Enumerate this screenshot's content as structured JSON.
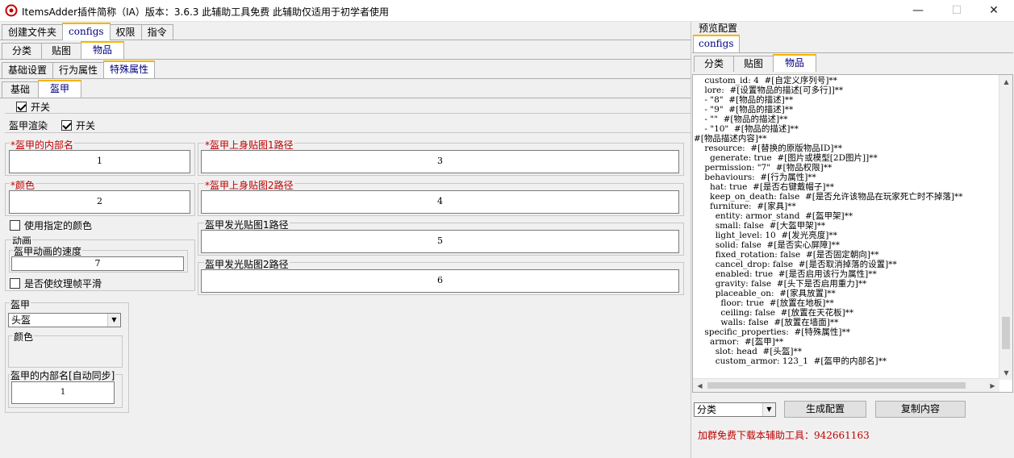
{
  "window": {
    "title": "ItemsAdder插件简称（IA）版本：3.6.3   此辅助工具免费   此辅助仅适用于初学者使用",
    "minimize": "—",
    "maximize": "☐",
    "close": "✕"
  },
  "tabs_main": [
    "创建文件夹",
    "configs",
    "权限",
    "指令"
  ],
  "tabs_sub": [
    "分类",
    "贴图",
    "物品"
  ],
  "tabs_item": [
    "基础设置",
    "行为属性",
    "特殊属性"
  ],
  "tabs_special": [
    "基础",
    "盔甲"
  ],
  "armor": {
    "toggle_label": "开关",
    "render_group": "盔甲渲染",
    "render_toggle": "开关",
    "internal_name_label": "*盔甲的内部名",
    "internal_name_value": "1",
    "color_label": "*颜色",
    "color_value": "2",
    "upper1_label": "*盔甲上身贴图1路径",
    "upper1_value": "3",
    "upper2_label": "*盔甲上身贴图2路径",
    "upper2_value": "4",
    "glow1_label": "盔甲发光贴图1路径",
    "glow1_value": "5",
    "glow2_label": "盔甲发光贴图2路径",
    "glow2_value": "6",
    "use_color_label": "使用指定的颜色",
    "anim_group": "动画",
    "anim_speed_label": "盔甲动画的速度",
    "anim_speed_value": "7",
    "smooth_label": "是否使纹理帧平滑",
    "armor_group": "盔甲",
    "slot_value": "头盔",
    "color_group": "颜色",
    "sync_label": "盔甲的内部名[自动同步]",
    "sync_value": "1"
  },
  "preview": {
    "title": "预览配置",
    "tab_configs": "configs",
    "tabs": [
      "分类",
      "贴图",
      "物品"
    ],
    "code": [
      "    custom_id: 4  #[自定义序列号]**",
      "    lore:  #[设置物品的描述[可多行]]**",
      "    - \"8\"  #[物品的描述]**",
      "    - \"9\"  #[物品的描述]**",
      "    - \"\"  #[物品的描述]**",
      "    - \"10\"  #[物品的描述]**",
      "#[物品描述内容]**",
      "    resource:  #[替换的原版物品ID]**",
      "      generate: true  #[图片或模型[2D图片]]**",
      "    permission: \"7\"  #[物品权限]**",
      "    behaviours:  #[行为属性]**",
      "      hat: true  #[是否右键戴帽子]**",
      "      keep_on_death: false  #[是否允许该物品在玩家死亡时不掉落]**",
      "      furniture:  #[家具]**",
      "        entity: armor_stand  #[盔甲架]**",
      "        small: false  #[大盔甲架]**",
      "        light_level: 10  #[发光亮度]**",
      "        solid: false  #[是否实心屏障]**",
      "        fixed_rotation: false  #[是否固定朝向]**",
      "        cancel_drop: false  #[是否取消掉落的设置]**",
      "        enabled: true  #[是否启用该行为属性]**",
      "        gravity: false  #[头下是否启用重力]**",
      "        placeable_on:  #[家具放置]**",
      "          floor: true  #[放置在地板]**",
      "          ceiling: false  #[放置在天花板]**",
      "          walls: false  #[放置在墙面]**",
      "    specific_properties:  #[特殊属性]**",
      "      armor:  #[盔甲]**",
      "        slot: head  #[头盔]**",
      "        custom_armor: 123_1  #[盔甲的内部名]**"
    ],
    "category_select": "分类",
    "generate_button": "生成配置",
    "copy_button": "复制内容",
    "promo": "加群免费下载本辅助工具：942661163"
  },
  "colors": {
    "active_tab_accent": "#f5b400",
    "required_label": "#c00000",
    "promo_text": "#c00000"
  }
}
